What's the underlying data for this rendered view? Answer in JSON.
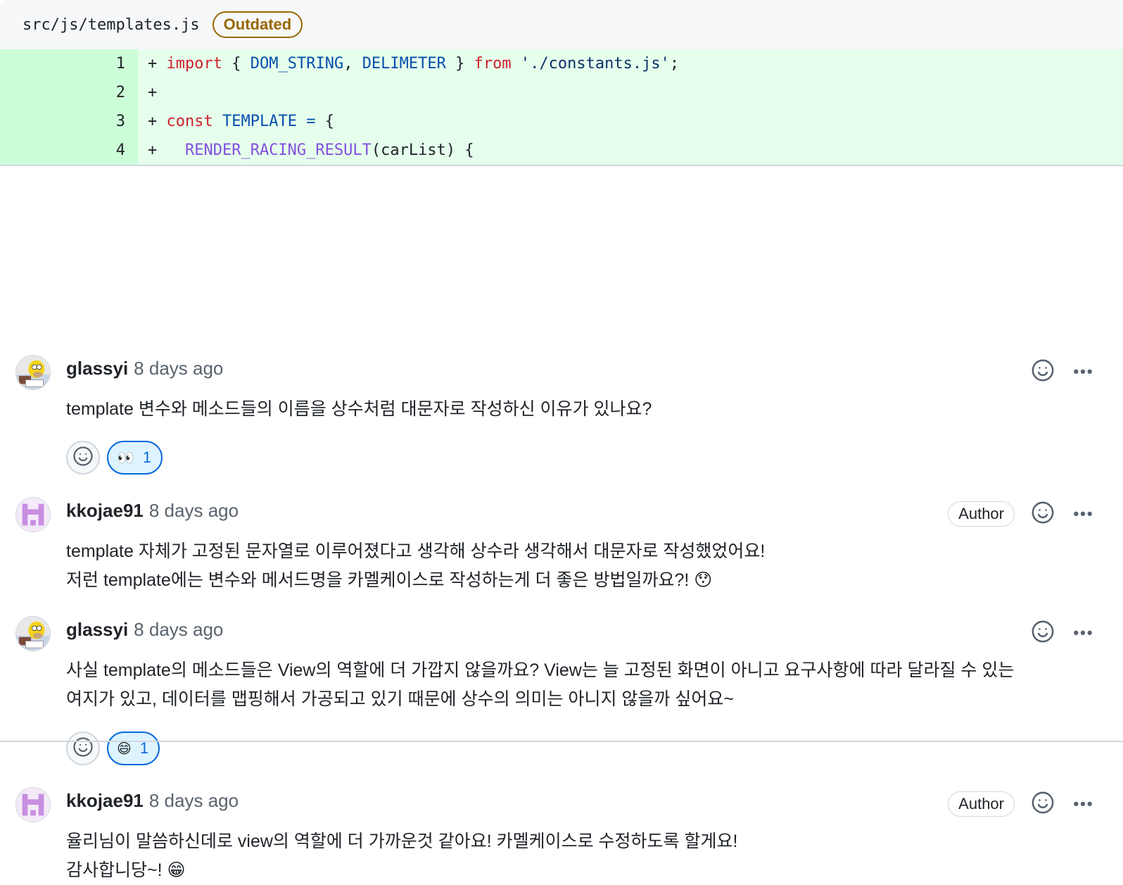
{
  "file": {
    "path": "src/js/templates.js",
    "badge": "Outdated"
  },
  "diff": [
    {
      "num": "1",
      "tokens": [
        {
          "t": "+ ",
          "c": "plain"
        },
        {
          "t": "import",
          "c": "kw"
        },
        {
          "t": " { ",
          "c": "plain"
        },
        {
          "t": "DOM_STRING",
          "c": "id"
        },
        {
          "t": ", ",
          "c": "plain"
        },
        {
          "t": "DELIMETER",
          "c": "id"
        },
        {
          "t": " } ",
          "c": "plain"
        },
        {
          "t": "from",
          "c": "kw"
        },
        {
          "t": " ",
          "c": "plain"
        },
        {
          "t": "'./constants.js'",
          "c": "str"
        },
        {
          "t": ";",
          "c": "plain"
        }
      ]
    },
    {
      "num": "2",
      "tokens": [
        {
          "t": "+",
          "c": "plain"
        }
      ]
    },
    {
      "num": "3",
      "tokens": [
        {
          "t": "+ ",
          "c": "plain"
        },
        {
          "t": "const",
          "c": "kw"
        },
        {
          "t": " ",
          "c": "plain"
        },
        {
          "t": "TEMPLATE",
          "c": "id"
        },
        {
          "t": " ",
          "c": "plain"
        },
        {
          "t": "=",
          "c": "id"
        },
        {
          "t": " {",
          "c": "plain"
        }
      ]
    },
    {
      "num": "4",
      "tokens": [
        {
          "t": "+   ",
          "c": "plain"
        },
        {
          "t": "RENDER_RACING_RESULT",
          "c": "fn"
        },
        {
          "t": "(carList) {",
          "c": "plain"
        }
      ]
    }
  ],
  "comments": [
    {
      "user": "glassyi",
      "time": "8 days ago",
      "author": false,
      "lines": [
        "template 변수와 메소드들의 이름을 상수처럼 대문자로 작성하신 이유가 있나요?"
      ],
      "reaction": {
        "emoji": "👀",
        "count": "1"
      }
    },
    {
      "user": "kkojae91",
      "time": "8 days ago",
      "author": true,
      "author_label": "Author",
      "lines": [
        "template 자체가 고정된 문자열로 이루어졌다고 생각해 상수라 생각해서 대문자로 작성했었어요!",
        "저런 template에는 변수와 메서드명을 카멜케이스로 작성하는게 더 좋은 방법일까요?! 😯"
      ],
      "reaction": null
    },
    {
      "user": "glassyi",
      "time": "8 days ago",
      "author": false,
      "lines": [
        "사실 template의 메소드들은 View의 역할에 더 가깝지 않을까요? View는 늘 고정된 화면이 아니고 요구사항에 따라 달라질 수 있는",
        "여지가 있고, 데이터를 맵핑해서 가공되고 있기 때문에 상수의 의미는 아니지 않을까 싶어요~"
      ],
      "reaction": {
        "emoji": "😄",
        "count": "1"
      }
    },
    {
      "user": "kkojae91",
      "time": "8 days ago",
      "author": true,
      "author_label": "Author",
      "lines": [
        "율리님이 말씀하신데로 view의 역할에 더 가까운것 같아요! 카멜케이스로 수정하도록 할게요!",
        "감사합니당~! 😁"
      ],
      "reaction": null
    }
  ],
  "icons": {
    "smiley": "smiley-icon",
    "kebab": "kebab-horizontal-icon"
  },
  "ui": {
    "kebab_glyph": "•••"
  }
}
